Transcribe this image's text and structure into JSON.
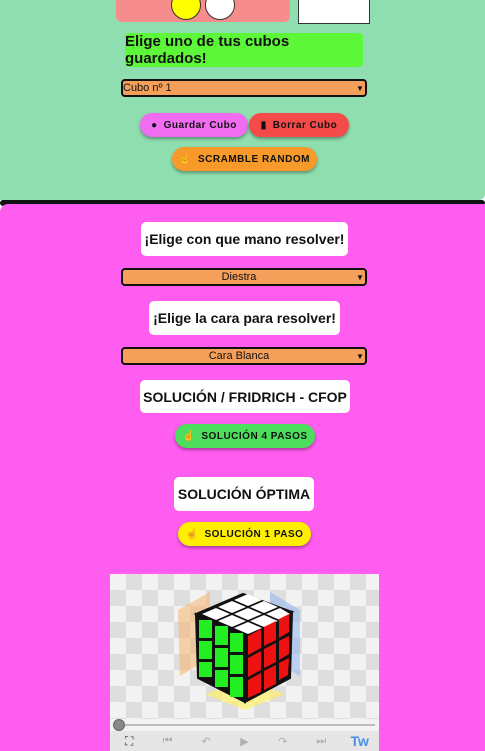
{
  "top_panel": {
    "title": "Elige uno de tus cubos guardados!",
    "cube_select": {
      "value": "Cubo nº 1"
    },
    "save_button": "Guardar Cubo",
    "delete_button": "Borrar Cubo",
    "scramble_button": "SCRAMBLE RANDOM",
    "colors": {
      "panel_bg": "#8fdeb0",
      "title_bg": "#5df73a",
      "swatch_yellow": "#ffff00",
      "swatch_white": "#ffffff"
    }
  },
  "bottom_panel": {
    "hand_title": "¡Elige con que mano resolver!",
    "hand_select": {
      "value": "Diestra"
    },
    "face_title": "¡Elige la cara para resolver!",
    "face_select": {
      "value": "Cara Blanca"
    },
    "cfop_title": "SOLUCIÓN / FRIDRICH - CFOP",
    "cfop_button": "SOLUCIÓN 4 PASOS",
    "optimal_title": "SOLUCIÓN ÓPTIMA",
    "optimal_button": "SOLUCIÓN 1 PASO",
    "colors": {
      "panel_bg": "#ff5cf0",
      "select_bg": "#f5a05a",
      "green_button": "#4cde5c",
      "yellow_button": "#ffee00"
    }
  },
  "player": {
    "twitter_label": "Tw",
    "progress": 0,
    "icons": [
      "fullscreen-icon",
      "skip-start-icon",
      "step-back-icon",
      "play-icon",
      "step-forward-icon",
      "skip-end-icon"
    ]
  }
}
